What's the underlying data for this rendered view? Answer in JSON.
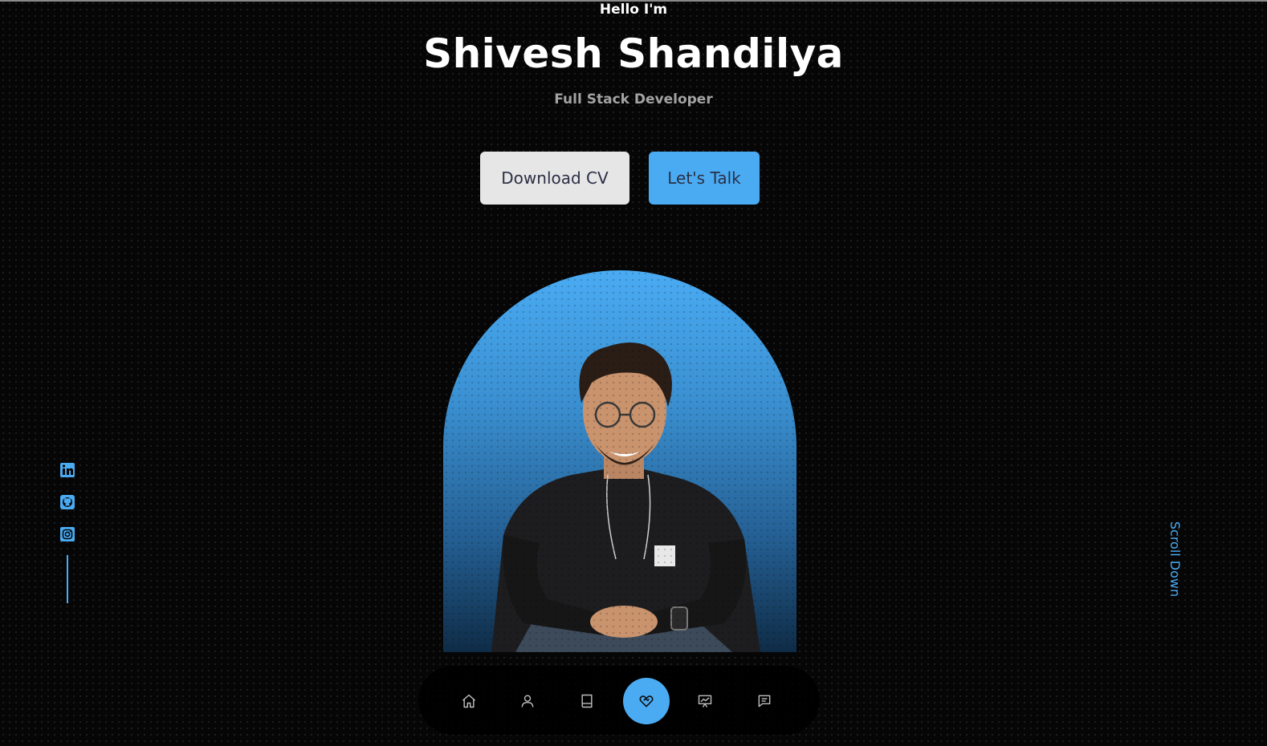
{
  "hero": {
    "greeting": "Hello I'm",
    "name": "Shivesh Shandilya",
    "role": "Full Stack Developer"
  },
  "buttons": {
    "download_cv": "Download CV",
    "lets_talk": "Let's Talk"
  },
  "socials": [
    "linkedin-icon",
    "github-icon",
    "instagram-icon"
  ],
  "scroll": {
    "label": "Scroll Down"
  },
  "nav": {
    "items": [
      "home-icon",
      "user-icon",
      "book-icon",
      "handshake-icon",
      "presentation-icon",
      "chat-icon"
    ],
    "active": "handshake-icon"
  },
  "colors": {
    "background": "#060606",
    "accent": "#4aabf3",
    "light_button": "#e6e6e6",
    "button_text": "#2b2f45",
    "subtitle": "#a3a3a3"
  }
}
